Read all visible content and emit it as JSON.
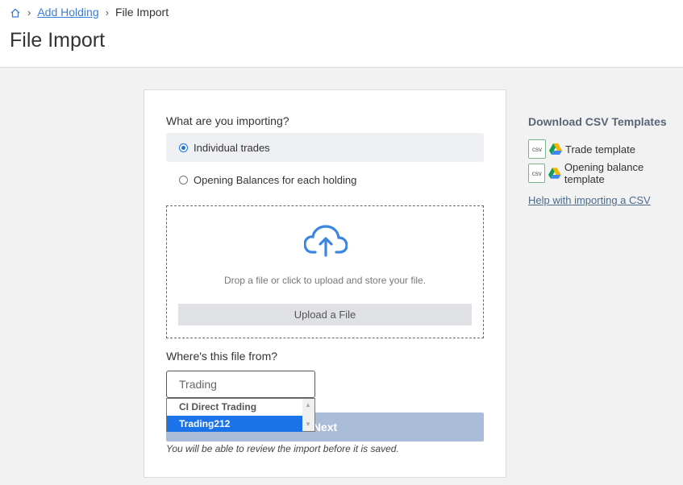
{
  "breadcrumb": {
    "home_icon": "home-icon",
    "link": "Add Holding",
    "current": "File Import"
  },
  "page": {
    "title": "File Import"
  },
  "form": {
    "question": "What are you importing?",
    "options": [
      {
        "label": "Individual trades",
        "checked": true
      },
      {
        "label": "Opening Balances for each holding",
        "checked": false
      }
    ],
    "dropzone": {
      "icon": "cloud-upload-icon",
      "text": "Drop a file or click to upload and store your file.",
      "button": "Upload a File"
    },
    "from_label": "Where's this file from?",
    "from_value": "Trading",
    "dropdown_options": [
      "CI Direct Trading",
      "Trading212"
    ],
    "dropdown_highlighted": "Trading212",
    "next_button": "Next",
    "note": "You will be able to review the import before it is saved."
  },
  "sidebar": {
    "title": "Download CSV Templates",
    "templates": [
      {
        "icon": "csv-file-icon",
        "label": "Trade template"
      },
      {
        "icon": "csv-file-icon",
        "label": "Opening balance template"
      }
    ],
    "csv_badge": "csv",
    "help_link": "Help with importing a CSV"
  },
  "colors": {
    "link": "#3b7dd8",
    "selected_option": "#1a73e8",
    "next_button": "#a9bcd8",
    "upload_button": "#dfe1e5"
  }
}
